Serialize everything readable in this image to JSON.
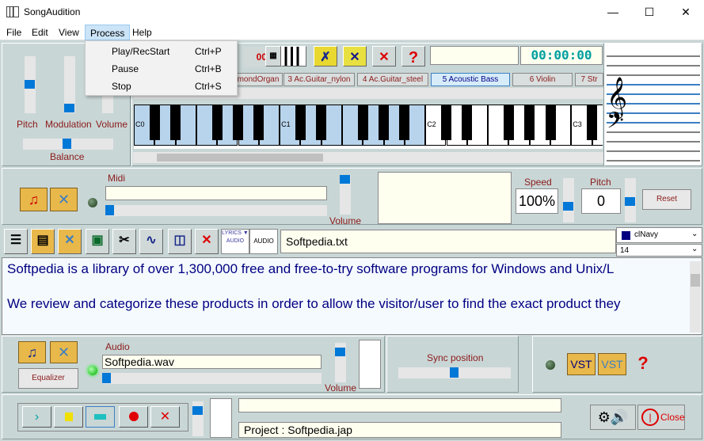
{
  "window": {
    "title": "SongAudition",
    "minimize": "—",
    "maximize": "☐",
    "close": "✕"
  },
  "menu": [
    "File",
    "Edit",
    "View",
    "Process",
    "Help"
  ],
  "process_menu": [
    {
      "label": "Play/RecStart",
      "shortcut": "Ctrl+P"
    },
    {
      "label": "Pause",
      "shortcut": "Ctrl+B"
    },
    {
      "label": "Stop",
      "shortcut": "Ctrl+S"
    }
  ],
  "mixer": {
    "pitch": "Pitch",
    "modulation": "Modulation",
    "volume": "Volume",
    "balance": "Balance"
  },
  "time_display": "00:00:00",
  "instruments": [
    "mondOrgan",
    "3 Ac.Guitar_nylon",
    "4 Ac.Guitar_steel",
    "5 Acoustic Bass",
    "6 Violin",
    "7 Str"
  ],
  "selected_instrument": "5 Acoustic Bass",
  "octaves": [
    "C0",
    "C1",
    "C2",
    "C3"
  ],
  "midi": {
    "label": "Midi",
    "file": "",
    "volume_label": "Volume"
  },
  "speed": {
    "label": "Speed",
    "value": "100%"
  },
  "pitch2": {
    "label": "Pitch",
    "value": "0"
  },
  "reset_label": "Reset",
  "lyrics": {
    "file": "Softpedia.txt",
    "color": "clNavy",
    "font_size": "14",
    "lines": [
      "Softpedia is a library of over 1,300,000 free and free-to-try software programs for Windows and Unix/L",
      "We review and categorize these products in order to allow the visitor/user to find the exact product they"
    ],
    "lyrics_icon": "LYRICS ▼ AUDIO",
    "audio_icon": "AUDIO"
  },
  "audio": {
    "label": "Audio",
    "file": "Softpedia.wav",
    "volume_label": "Volume",
    "equalizer": "Equalizer"
  },
  "sync_label": "Sync position",
  "vst_label": "VST",
  "project": {
    "status": "",
    "name": "Project : Softpedia.jap"
  },
  "close_label": "Close",
  "help_glyph": "?",
  "accent": "#0078d7"
}
